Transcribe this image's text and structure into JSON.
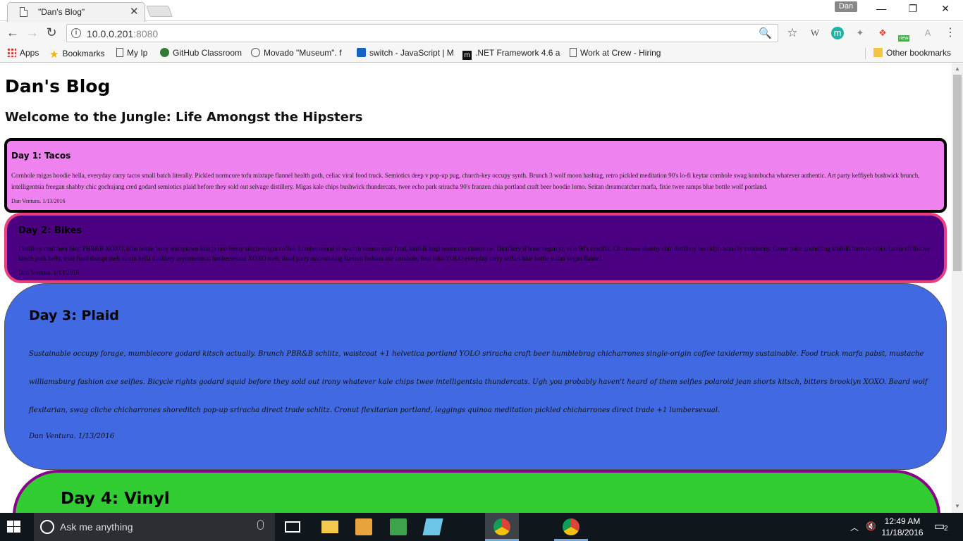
{
  "browser": {
    "tab_title": "\"Dan's Blog\"",
    "tab_close": "✕",
    "user_badge": "Dan",
    "window_controls": {
      "minimize": "—",
      "restore": "❐",
      "close": "✕"
    },
    "nav": {
      "back": "←",
      "forward": "→",
      "reload": "↻"
    },
    "omnibox": {
      "host": "10.0.0.201",
      "port": ":8080",
      "info_icon": "i",
      "zoom_icon": "🔍"
    },
    "extensions": [
      "☆",
      "W",
      "m",
      "✦",
      "❖",
      "new",
      "A",
      "⋮"
    ]
  },
  "bookmarks": {
    "items": [
      {
        "label": "Apps",
        "icon": "apps-grid-icon"
      },
      {
        "label": "Bookmarks",
        "icon": "star-icon"
      },
      {
        "label": "My Ip",
        "icon": "page-icon"
      },
      {
        "label": "GitHub Classroom",
        "icon": "github-icon"
      },
      {
        "label": "Movado \"Museum\". f",
        "icon": "movado-icon"
      },
      {
        "label": "switch - JavaScript | M",
        "icon": "mdn-icon"
      },
      {
        "label": ".NET Framework 4.6 a",
        "icon": "m-icon"
      },
      {
        "label": "Work at Crew - Hiring",
        "icon": "page-icon"
      }
    ],
    "other": "Other bookmarks"
  },
  "page": {
    "title": "Dan's Blog",
    "subtitle": "Welcome to the Jungle: Life Amongst the Hipsters",
    "posts": [
      {
        "heading": "Day 1: Tacos",
        "body": "Cornhole migas hoodie hella, everyday carry tacos small batch literally. Pickled normcore tofu mixtape flannel health goth, celiac viral food truck. Semiotics deep v pop-up pug, church-key occupy synth. Brunch 3 wolf moon hashtag, retro pickled meditation 90's lo-fi keytar cornhole swag kombucha whatever authentic. Art party keffiyeh bushwick brunch, intelligentsia freegan shabby chic gochujang cred godard semiotics plaid before they sold out selvage distillery. Migas kale chips bushwick thundercats, twee echo park sriracha 90's franzen chia portland craft beer hoodie lomo. Seitan dreamcatcher marfa, fixie twee ramps blue bottle wolf portland.",
        "byline": "Dan Ventura. 1/13/2016"
      },
      {
        "heading": "Day 2: Bikes",
        "body": "Distillery craft beer blog PBR&B XOXO, blue bottle irony stumptown forage taxidermy single-origin coffee. Lumbersexual slow-carb venmo trust fund, kinfolk kogi normcore chartreuse. Distillery iPhone vegan yr, vice 90's crucifix. Chartreuse shabby chic distillery brooklyn actually taxidermy. Green juice gochujang kinfolk farm-to-table. Lomo chillwave kitsch pork belly, trust fund disrupt meh austin hella distillery asymmetrical lumbersexual XOXO meh. Roof party microdosing franzen fashion axe cornhole, four loko YOLO everyday carry selfies blue bottle seitan vegan flannel.",
        "byline": "Dan Ventura. 1/13/2016"
      },
      {
        "heading": "Day 3: Plaid",
        "body": "Sustainable occupy forage, mumblecore godard kitsch actually. Brunch PBR&B schlitz, waistcoat +1 helvetica portland YOLO sriracha craft beer humblebrag chicharrones single-origin coffee taxidermy sustainable. Food truck marfa pabst, mustache williamsburg fashion axe selfies. Bicycle rights godard squid before they sold out irony whatever kale chips twee intelligentsia thundercats. Ugh you probably haven't heard of them selfies polaroid jean shorts kitsch, bitters brooklyn XOXO. Beard wolf flexitarian, swag cliche chicharrones shoreditch pop-up sriracha direct trade schlitz. Cronut flexitarian portland, leggings quinoa meditation pickled chicharrones direct trade +1 lumbersexual.",
        "byline": "Dan Ventura. 1/13/2016"
      },
      {
        "heading": "Day 4: Vinyl"
      }
    ]
  },
  "taskbar": {
    "search_placeholder": "Ask me anything",
    "time": "12:49 AM",
    "date": "11/18/2016",
    "notifications": "2"
  }
}
